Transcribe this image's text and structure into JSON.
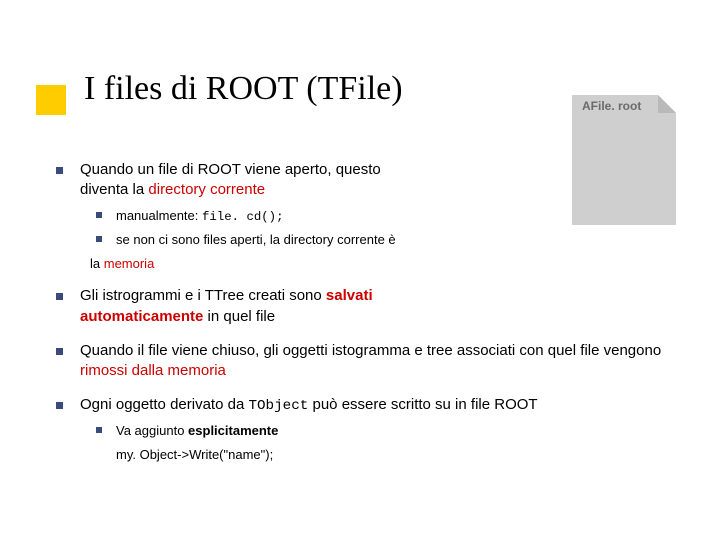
{
  "title": "I files di ROOT (TFile)",
  "fileIcon": {
    "label": "AFile. root"
  },
  "bullets": {
    "b1": {
      "pre": "Quando un file di ROOT viene aperto, questo diventa la ",
      "red": "directory corrente",
      "sub": {
        "s1_pre": "manualmente: ",
        "s1_code": "file. cd();",
        "s2": "se non ci sono files aperti, la directory corrente è",
        "trailing_pre": "la ",
        "trailing_red": "memoria"
      }
    },
    "b2": {
      "pre1": "Gli istrogrammi e i TTree creati sono ",
      "bold_red": "salvati automaticamente",
      "post1": " in quel file"
    },
    "b3": {
      "pre": "Quando il file viene chiuso, gli oggetti istogramma e tree associati con quel file vengono ",
      "red": "rimossi dalla memoria"
    },
    "b4": {
      "pre": "Ogni oggetto derivato da ",
      "code": "TObject",
      "post": " può essere scritto su in file ROOT",
      "sub": {
        "s1_pre": "Va aggiunto ",
        "s1_bold": "esplicitamente",
        "codeline": "my. Object->Write(\"name\");"
      }
    }
  }
}
